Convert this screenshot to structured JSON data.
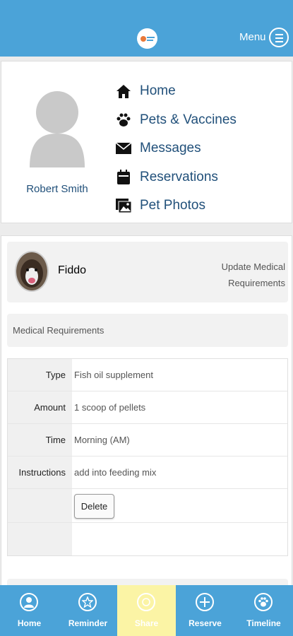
{
  "header": {
    "menu_label": "Menu",
    "logo": "app-logo"
  },
  "profile": {
    "user_name": "Robert Smith",
    "nav": [
      {
        "label": "Home",
        "icon": "home-icon"
      },
      {
        "label": "Pets & Vaccines",
        "icon": "paw-icon"
      },
      {
        "label": "Messages",
        "icon": "envelope-icon"
      },
      {
        "label": "Reservations",
        "icon": "calendar-icon"
      },
      {
        "label": "Pet Photos",
        "icon": "photos-icon"
      }
    ]
  },
  "pet": {
    "name": "Fiddo",
    "update_link": "Update Medical Requirements"
  },
  "medical": {
    "title": "Medical Requirements",
    "rows": [
      {
        "label": "Type",
        "value": "Fish oil supplement"
      },
      {
        "label": "Amount",
        "value": "1 scoop of pellets"
      },
      {
        "label": "Time",
        "value": "Morning (AM)"
      },
      {
        "label": "Instructions",
        "value": "add into feeding mix"
      }
    ],
    "delete_label": "Delete"
  },
  "bottom_nav": [
    {
      "label": "Home",
      "icon": "user-icon"
    },
    {
      "label": "Reminder",
      "icon": "star-icon"
    },
    {
      "label": "Share",
      "icon": "share-icon",
      "active": true
    },
    {
      "label": "Reserve",
      "icon": "plus-icon"
    },
    {
      "label": "Timeline",
      "icon": "paw-icon"
    }
  ],
  "colors": {
    "primary": "#4ba3d8",
    "link_text": "#21507a",
    "active_tab": "#fbf4a5"
  }
}
